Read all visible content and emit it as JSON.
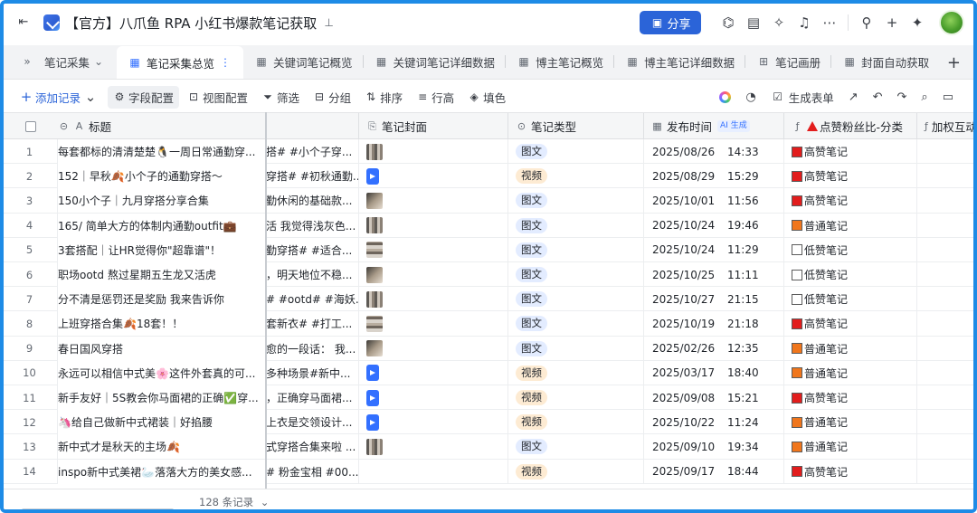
{
  "title_bar": {
    "doc_title": "【官方】八爪鱼 RPA 小红书爆款笔记获取",
    "share_label": "分享"
  },
  "tabs": {
    "collapsed_label": "笔记采集",
    "items": [
      {
        "label": "笔记采集总览",
        "icon": "table-icon",
        "active": true
      },
      {
        "label": "关键词笔记概览",
        "icon": "table-icon"
      },
      {
        "label": "关键词笔记详细数据",
        "icon": "table-icon"
      },
      {
        "label": "博主笔记概览",
        "icon": "table-icon"
      },
      {
        "label": "博主笔记详细数据",
        "icon": "table-icon"
      },
      {
        "label": "笔记画册",
        "icon": "gallery-icon"
      },
      {
        "label": "封面自动获取",
        "icon": "table-icon"
      }
    ]
  },
  "toolbar": {
    "add_record": "添加记录",
    "field_config": "字段配置",
    "view_config": "视图配置",
    "filter": "筛选",
    "group": "分组",
    "sort": "排序",
    "row_height": "行高",
    "fill_color": "填色",
    "generate_form": "生成表单"
  },
  "columns": {
    "title": "标题",
    "cover": "笔记封面",
    "type": "笔记类型",
    "publish_time": "发布时间",
    "ai_tag": "AI 生成",
    "ratio": "点赞粉丝比-分类",
    "extra": "加权互动"
  },
  "rows": [
    {
      "idx": "1",
      "title": "每套都标的清清楚楚🐧一周日常通勤穿...",
      "hidden": "搭# #小个子穿...",
      "cover": "image",
      "type": "图文",
      "date": "2025/08/26",
      "time": "14:33",
      "ratio": "高赞笔记",
      "ratio_color": "red"
    },
    {
      "idx": "2",
      "title": "152｜早秋🍂小个子的通勤穿搭～",
      "hidden": "穿搭# #初秋通勤...",
      "cover": "video",
      "type": "视频",
      "date": "2025/08/29",
      "time": "15:29",
      "ratio": "高赞笔记",
      "ratio_color": "red"
    },
    {
      "idx": "3",
      "title": "150小个子｜九月穿搭分享合集",
      "hidden": "勤休闲的基础款...",
      "cover": "image",
      "type": "图文",
      "date": "2025/10/01",
      "time": "11:56",
      "ratio": "高赞笔记",
      "ratio_color": "red"
    },
    {
      "idx": "4",
      "title": "165/ 简单大方的体制内通勤outfit💼",
      "hidden": "活 我觉得浅灰色...",
      "cover": "image",
      "type": "图文",
      "date": "2025/10/24",
      "time": "19:46",
      "ratio": "普通笔记",
      "ratio_color": "orange"
    },
    {
      "idx": "5",
      "title": "3套搭配｜让HR觉得你\"超靠谱\"！",
      "hidden": "勤穿搭# #适合...",
      "cover": "image",
      "type": "图文",
      "date": "2025/10/24",
      "time": "11:29",
      "ratio": "低赞笔记",
      "ratio_color": "white"
    },
    {
      "idx": "6",
      "title": "职场ootd 熬过星期五生龙又活虎",
      "hidden": "，明天地位不稳...",
      "cover": "image",
      "type": "图文",
      "date": "2025/10/25",
      "time": "11:11",
      "ratio": "低赞笔记",
      "ratio_color": "white"
    },
    {
      "idx": "7",
      "title": "分不清是惩罚还是奖励 我来告诉你",
      "hidden": "# #ootd# #海妖...",
      "cover": "image",
      "type": "图文",
      "date": "2025/10/27",
      "time": "21:15",
      "ratio": "低赞笔记",
      "ratio_color": "white"
    },
    {
      "idx": "8",
      "title": "上班穿搭合集🍂18套！！",
      "hidden": "套新衣# #打工...",
      "cover": "image",
      "type": "图文",
      "date": "2025/10/19",
      "time": "21:18",
      "ratio": "高赞笔记",
      "ratio_color": "red"
    },
    {
      "idx": "9",
      "title": "春日国风穿搭",
      "hidden": "愈的一段话： 我...",
      "cover": "image",
      "type": "图文",
      "date": "2025/02/26",
      "time": "12:35",
      "ratio": "普通笔记",
      "ratio_color": "orange"
    },
    {
      "idx": "10",
      "title": "永远可以相信中式美🌸这件外套真的可...",
      "hidden": "多种场景#新中...",
      "cover": "video",
      "type": "视频",
      "date": "2025/03/17",
      "time": "18:40",
      "ratio": "普通笔记",
      "ratio_color": "orange"
    },
    {
      "idx": "11",
      "title": "新手友好｜5S教会你马面裙的正确✅穿...",
      "hidden": "，正确穿马面裙...",
      "cover": "video",
      "type": "视频",
      "date": "2025/09/08",
      "time": "15:21",
      "ratio": "高赞笔记",
      "ratio_color": "red"
    },
    {
      "idx": "12",
      "title": "🦄给自己做新中式裙装｜好掐腰",
      "hidden": "上衣是交领设计...",
      "cover": "video",
      "type": "视频",
      "date": "2025/10/22",
      "time": "11:24",
      "ratio": "普通笔记",
      "ratio_color": "orange"
    },
    {
      "idx": "13",
      "title": "新中式才是秋天的主场🍂",
      "hidden": "式穿搭合集来啦 ...",
      "cover": "image",
      "type": "图文",
      "date": "2025/09/10",
      "time": "19:34",
      "ratio": "普通笔记",
      "ratio_color": "orange"
    },
    {
      "idx": "14",
      "title": "inspo新中式美裙🦢落落大方的美女感...",
      "hidden": "# 粉金宝相 #00...",
      "cover": "none",
      "type": "视频",
      "date": "2025/09/17",
      "time": "18:44",
      "ratio": "高赞笔记",
      "ratio_color": "red"
    }
  ],
  "footer": {
    "record_count": "128 条记录"
  }
}
